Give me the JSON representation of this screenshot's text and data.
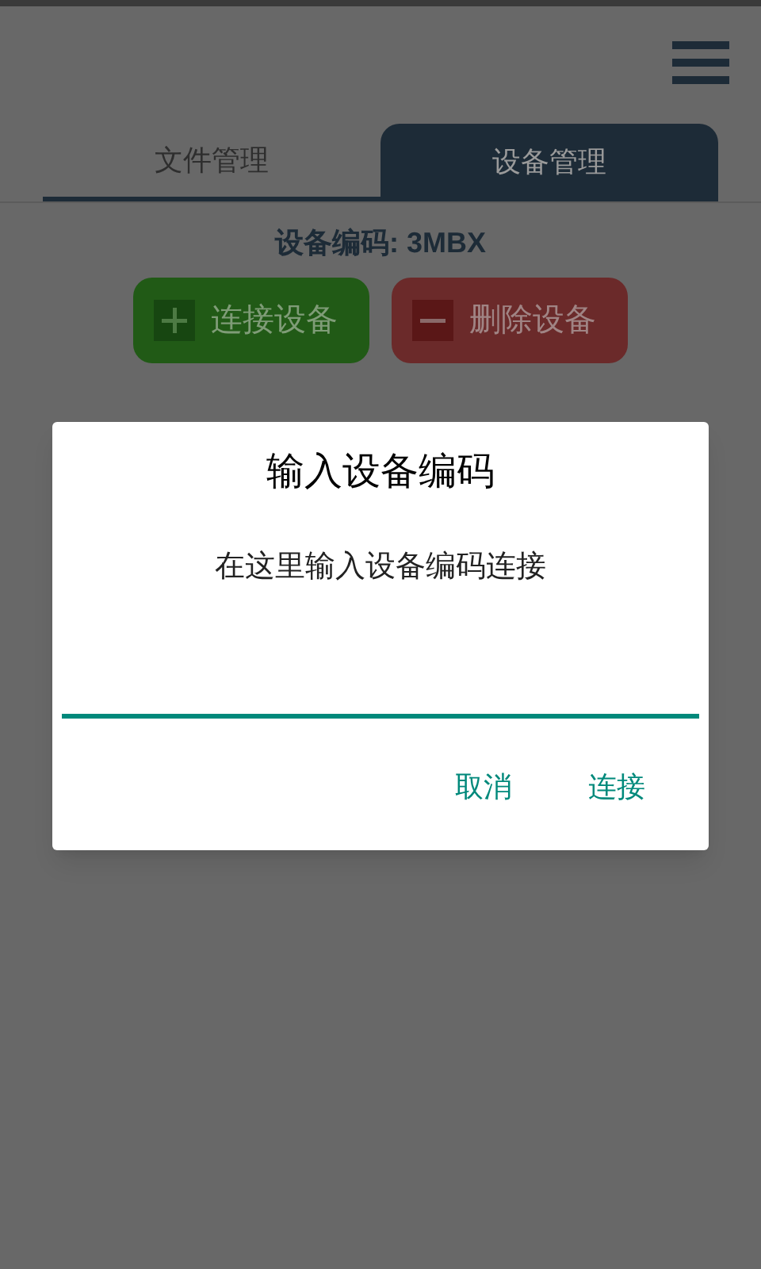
{
  "tabs": [
    {
      "label": "文件管理",
      "selected": false
    },
    {
      "label": "设备管理",
      "selected": true
    }
  ],
  "device_code": "设备编码: 3MBX",
  "actions": [
    {
      "kind": "add",
      "label": "连接设备"
    },
    {
      "kind": "remove",
      "label": "删除设备"
    }
  ],
  "dialog": {
    "title": "输入设备编码",
    "message": "在这里输入设备编码连接",
    "buttons": [
      "取消",
      "连接"
    ]
  }
}
